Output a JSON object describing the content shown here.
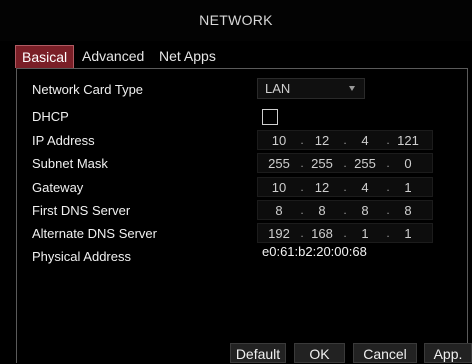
{
  "window": {
    "title": "NETWORK"
  },
  "tabs": [
    {
      "label": "Basical",
      "active": true
    },
    {
      "label": "Advanced",
      "active": false
    },
    {
      "label": "Net Apps",
      "active": false
    }
  ],
  "fields": {
    "network_card_type": {
      "label": "Network Card Type",
      "value": "LAN"
    },
    "dhcp": {
      "label": "DHCP",
      "checked": false
    },
    "ip_address": {
      "label": "IP Address",
      "octets": [
        "10",
        "12",
        "4",
        "121"
      ]
    },
    "subnet_mask": {
      "label": "Subnet Mask",
      "octets": [
        "255",
        "255",
        "255",
        "0"
      ]
    },
    "gateway": {
      "label": "Gateway",
      "octets": [
        "10",
        "12",
        "4",
        "1"
      ]
    },
    "first_dns": {
      "label": "First DNS Server",
      "octets": [
        "8",
        "8",
        "8",
        "8"
      ]
    },
    "alternate_dns": {
      "label": "Alternate DNS Server",
      "octets": [
        "192",
        "168",
        "1",
        "1"
      ]
    },
    "physical_address": {
      "label": "Physical Address",
      "value": "e0:61:b2:20:00:68"
    }
  },
  "separator": ".",
  "buttons": {
    "default": "Default",
    "ok": "OK",
    "cancel": "Cancel",
    "apply": "App."
  },
  "colors": {
    "active_tab": "#7a1f27",
    "background": "#000000"
  }
}
